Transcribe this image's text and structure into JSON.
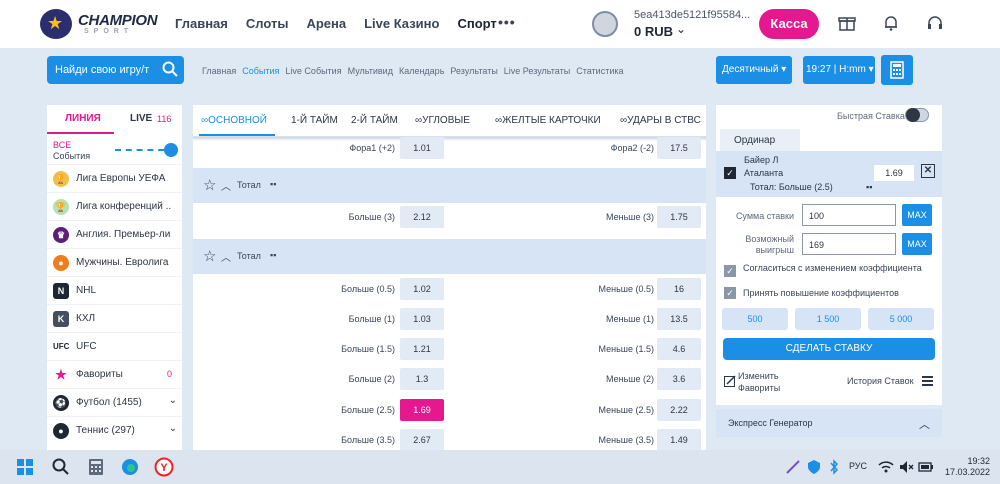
{
  "header": {
    "logo_text": "CHAMPION",
    "logo_sub": "SPORT",
    "nav": [
      "Главная",
      "Слоты",
      "Арена",
      "Live Казино",
      "Спорт"
    ],
    "more": "•••",
    "account_id": "5ea413de5121f95584...",
    "balance": "0 RUB",
    "kassa": "Касса"
  },
  "subbar": {
    "search_placeholder": "Найди свою игру/т",
    "links": [
      "Главная",
      "События",
      "Live События",
      "Мультивид",
      "Календарь",
      "Результаты",
      "Live Результаты",
      "Статистика"
    ],
    "active_link": "События",
    "odds_format": "Десятичный",
    "time_format": "19:27 | H:mm"
  },
  "sidebar": {
    "tab_line": "ЛИНИЯ",
    "tab_live": "LIVE",
    "live_count": "116",
    "all": "ВСЕ",
    "events": "События",
    "items": [
      {
        "label": "Лига Европы УЕФА",
        "count": "",
        "chevron": false,
        "icon": "europa-league-icon"
      },
      {
        "label": "Лига конференций ...",
        "count": "",
        "chevron": false,
        "icon": "conference-league-icon"
      },
      {
        "label": "Англия. Премьер-ли...",
        "count": "",
        "chevron": false,
        "icon": "premier-league-icon"
      },
      {
        "label": "Мужчины. Евролига",
        "count": "",
        "chevron": false,
        "icon": "basketball-icon"
      },
      {
        "label": "NHL",
        "count": "",
        "chevron": false,
        "icon": "nhl-icon"
      },
      {
        "label": "КХЛ",
        "count": "",
        "chevron": false,
        "icon": "khl-icon"
      },
      {
        "label": "UFC",
        "count": "",
        "chevron": false,
        "icon": "ufc-icon"
      },
      {
        "label": "Фавориты",
        "count": "0",
        "chevron": false,
        "icon": "star-icon"
      },
      {
        "label": "Футбол (1455)",
        "count": "",
        "chevron": true,
        "icon": "football-icon"
      },
      {
        "label": "Теннис (297)",
        "count": "",
        "chevron": true,
        "icon": "tennis-icon"
      }
    ]
  },
  "tabs": [
    "ОСНОВНОЙ",
    "1-Й ТАЙМ",
    "2-Й ТАЙМ",
    "УГЛОВЫЕ",
    "ЖЕЛТЫЕ КАРТОЧКИ",
    "УДАРЫ В СТВС"
  ],
  "markets": {
    "fora_row": {
      "left_label": "Фора1 (+2)",
      "left_odd": "1.01",
      "right_label": "Фора2 (-2)",
      "right_odd": "17.5"
    },
    "total1": {
      "title": "Тотал",
      "rows": [
        {
          "left_label": "Больше (3)",
          "left_odd": "2.12",
          "right_label": "Меньше (3)",
          "right_odd": "1.75"
        }
      ]
    },
    "total2": {
      "title": "Тотал",
      "rows": [
        {
          "left_label": "Больше (0.5)",
          "left_odd": "1.02",
          "right_label": "Меньше (0.5)",
          "right_odd": "16"
        },
        {
          "left_label": "Больше (1)",
          "left_odd": "1.03",
          "right_label": "Меньше (1)",
          "right_odd": "13.5"
        },
        {
          "left_label": "Больше (1.5)",
          "left_odd": "1.21",
          "right_label": "Меньше (1.5)",
          "right_odd": "4.6"
        },
        {
          "left_label": "Больше (2)",
          "left_odd": "1.3",
          "right_label": "Меньше (2)",
          "right_odd": "3.6"
        },
        {
          "left_label": "Больше (2.5)",
          "left_odd": "1.69",
          "right_label": "Меньше (2.5)",
          "right_odd": "2.22",
          "selected": true
        },
        {
          "left_label": "Больше (3.5)",
          "left_odd": "2.67",
          "right_label": "Меньше (3.5)",
          "right_odd": "1.49"
        }
      ]
    }
  },
  "betslip": {
    "quick_bet": "Быстрая Ставка",
    "tab": "Ординар",
    "team1": "Байер Л",
    "team2": "Аталанта",
    "odd": "1.69",
    "market": "Тотал: Больше (2.5)",
    "stake_label": "Сумма ставки",
    "stake_value": "100",
    "win_label": "Возможный выигрыш",
    "win_value": "169",
    "max": "MAX",
    "agree_change": "Согласиться с изменением коэффициента",
    "accept_raise": "Принять повышение коэффициентов",
    "quick_amounts": [
      "500",
      "1 500",
      "5 000"
    ],
    "place_bet": "СДЕЛАТЬ СТАВКУ",
    "edit_fav": "Изменить Фавориты",
    "history": "История Ставок",
    "express": "Экспресс Генератор"
  },
  "taskbar": {
    "lang": "РУС",
    "time": "19:32",
    "date": "17.03.2022"
  },
  "colors": {
    "accent": "#1b8ee6",
    "brand": "#e6188f",
    "market_bg": "#d6e4f6"
  }
}
